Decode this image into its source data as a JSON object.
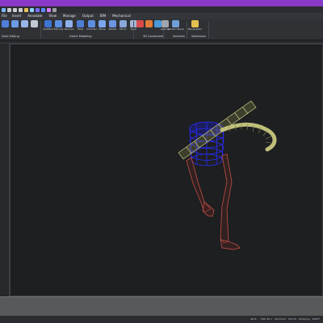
{
  "menubar": {
    "items": [
      "File",
      "Insert",
      "Annotate",
      "View",
      "Manage",
      "Output",
      "BIM",
      "Mechanical"
    ]
  },
  "ribbon": {
    "groups": [
      {
        "label": "Solid Editing",
        "buttons": [
          "",
          "",
          "",
          ""
        ]
      },
      {
        "label": "",
        "buttons": [
          "PushPull",
          "Extrude",
          "Revolve"
        ]
      },
      {
        "label": "Direct Modeling",
        "buttons": [
          "Fillet",
          "Chamfer",
          "Move",
          "Rotate",
          "Mirror",
          "Taper",
          "Copy Faces"
        ]
      },
      {
        "label": "3D Constraints",
        "buttons": [
          "",
          "",
          "",
          ""
        ]
      },
      {
        "label": "Sections",
        "buttons": [
          "Options",
          "Section Plane"
        ]
      },
      {
        "label": "Selections",
        "buttons": [
          "Manipulator"
        ]
      }
    ]
  },
  "status": {
    "items": [
      "4D.8…",
      "DRC 85.1",
      "Standard",
      "ISO-25",
      "Modeling",
      "RIGHT"
    ]
  },
  "colors": {
    "titlebar": "#8a38c7",
    "viewport": "#1d1f21",
    "cylinder": "#2b2bff",
    "hose_bend": "#c0bf7a",
    "legs": "#a4433d"
  },
  "viewport": {
    "content": "3d-wireframe-model"
  }
}
